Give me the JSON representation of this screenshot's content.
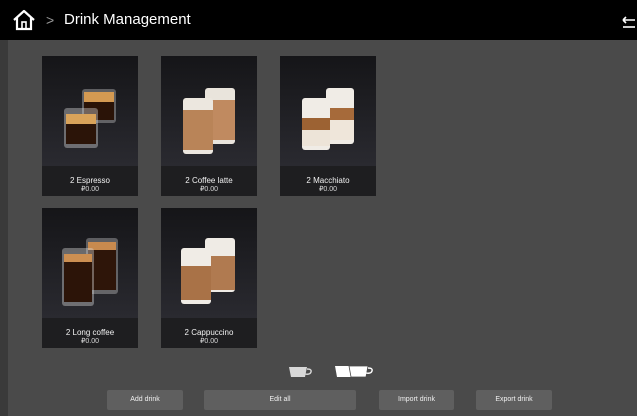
{
  "header": {
    "title": "Drink Management",
    "separator": ">"
  },
  "drinks": [
    {
      "name": "2 Espresso",
      "price": "₽0.00",
      "kind": "espresso"
    },
    {
      "name": "2 Coffee latte",
      "price": "₽0.00",
      "kind": "latte"
    },
    {
      "name": "2 Macchiato",
      "price": "₽0.00",
      "kind": "macchiato"
    },
    {
      "name": "2 Long coffee",
      "price": "₽0.00",
      "kind": "long-coffee"
    },
    {
      "name": "2 Cappuccino",
      "price": "₽0.00",
      "kind": "cappuccino"
    }
  ],
  "footer": {
    "add_label": "Add drink",
    "edit_label": "Edit all",
    "import_label": "Import drink",
    "export_label": "Export drink"
  },
  "icons": {
    "home": "home-icon",
    "back": "back-arrow-icon",
    "single_cup": "single-cup-icon",
    "double_cup": "double-cup-icon"
  }
}
